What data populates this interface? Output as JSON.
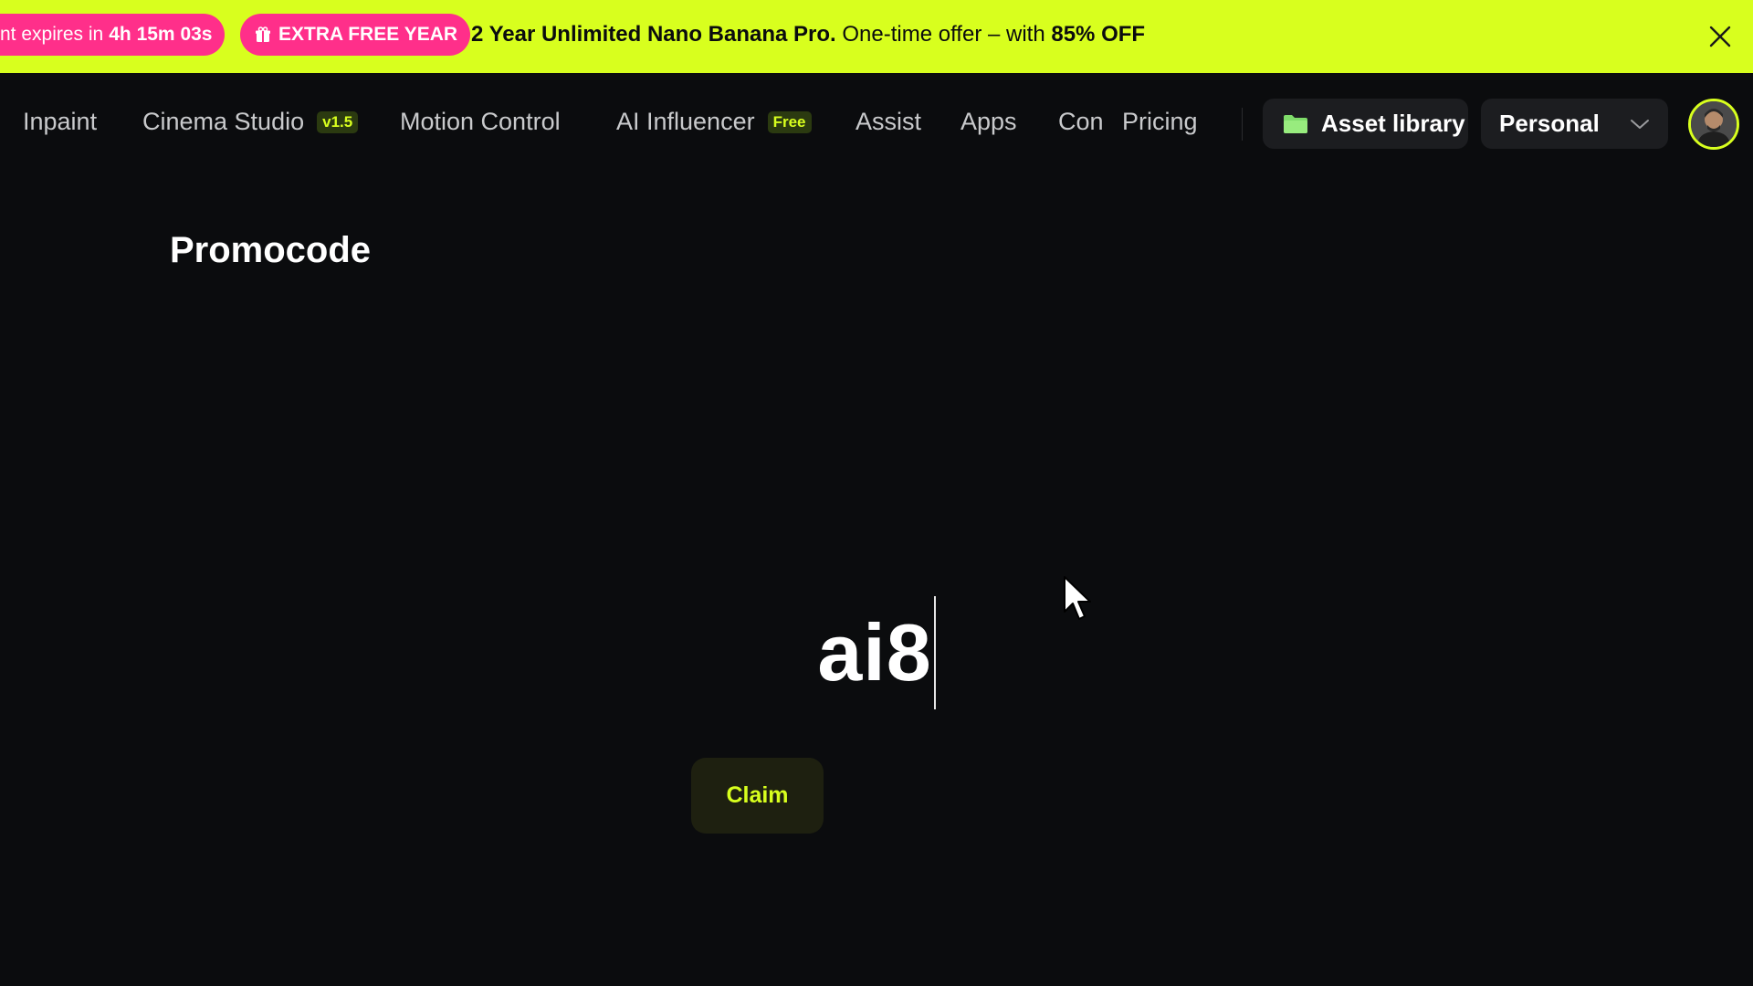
{
  "banner": {
    "timer_prefix": "nt expires in",
    "timer_value": "4h 15m 03s",
    "extra_label": "EXTRA FREE YEAR",
    "offer_bold": "2 Year Unlimited Nano Banana Pro.",
    "offer_text": "One-time offer – with",
    "offer_discount": "85% OFF",
    "bg_color": "#d8ff1e",
    "pill_color": "#ff2f8a",
    "close_icon": "close-icon"
  },
  "nav": {
    "items": [
      {
        "label": "Inpaint"
      },
      {
        "label": "Cinema Studio",
        "badge": "v1.5"
      },
      {
        "label": "Motion Control"
      },
      {
        "label": "AI Influencer",
        "badge": "Free"
      },
      {
        "label": "Assist"
      },
      {
        "label": "Apps"
      },
      {
        "label": "Con"
      },
      {
        "label": "Pricing"
      }
    ],
    "asset_library": "Asset library",
    "workspace": "Personal"
  },
  "main": {
    "title": "Promocode",
    "code_value": "ai8",
    "claim_label": "Claim"
  },
  "colors": {
    "accent": "#d8ff1e",
    "background": "#0b0c0e",
    "surface": "#1c1d20"
  }
}
